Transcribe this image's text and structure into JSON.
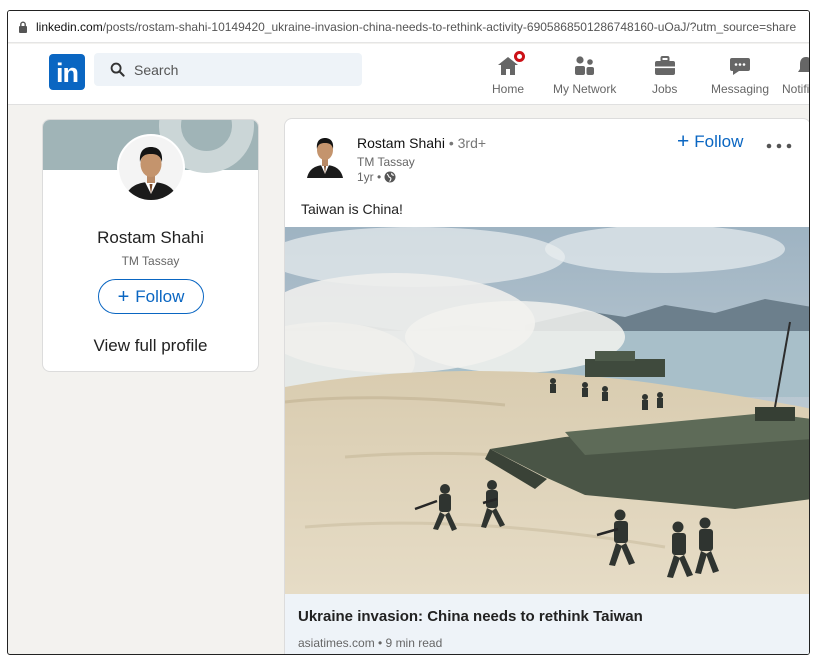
{
  "browser": {
    "url_host": "linkedin.com",
    "url_path": "/posts/rostam-shahi-10149420_ukraine-invasion-china-needs-to-rethink-activity-6905868501286748160-uOaJ/?utm_source=share"
  },
  "nav": {
    "logo": "in",
    "search_placeholder": "Search",
    "items": [
      {
        "label": "Home",
        "icon": "home-icon"
      },
      {
        "label": "My Network",
        "icon": "network-icon"
      },
      {
        "label": "Jobs",
        "icon": "briefcase-icon"
      },
      {
        "label": "Messaging",
        "icon": "messaging-icon"
      },
      {
        "label": "Notifi",
        "icon": "bell-icon"
      }
    ]
  },
  "profile": {
    "name": "Rostam Shahi",
    "subtitle": "TM Tassay",
    "follow_label": "Follow",
    "view_profile": "View full profile"
  },
  "post": {
    "author": "Rostam Shahi",
    "degree": " • 3rd+",
    "author_subtitle": "TM Tassay",
    "time": "1yr •",
    "follow_label": "Follow",
    "text": "Taiwan is China!",
    "article_title": "Ukraine invasion: China needs to rethink Taiwan",
    "article_source": "asiatimes.com • 9 min read"
  },
  "colors": {
    "brand": "#0a66c2",
    "notification_badge": "#cc1016",
    "page_bg": "#f3f2ef",
    "article_bg": "#eef3f8"
  }
}
